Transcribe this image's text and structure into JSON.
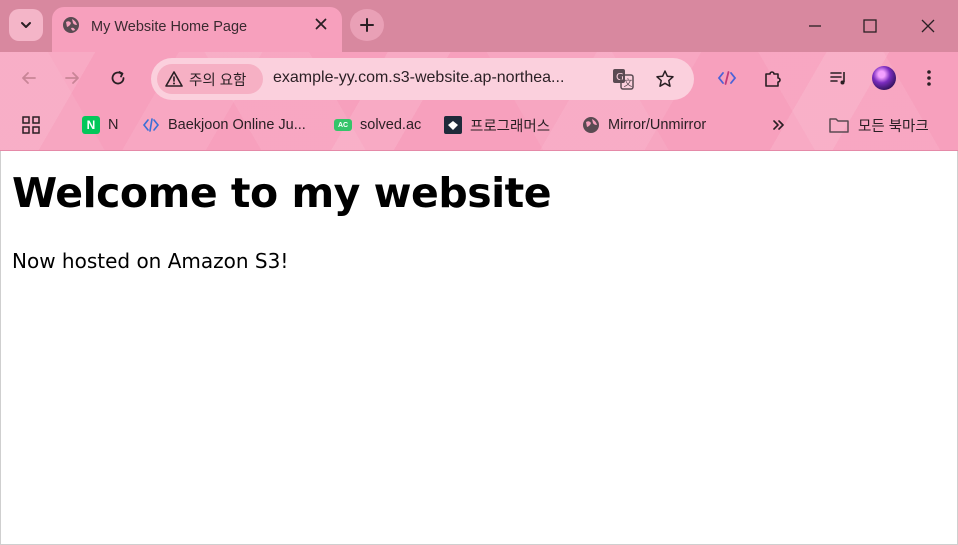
{
  "tab": {
    "title": "My Website Home Page",
    "favicon": "globe-icon"
  },
  "toolbar": {
    "security_chip": "주의 요함",
    "url": "example-yy.com.s3-website.ap-northea..."
  },
  "bookmarks": {
    "items": [
      {
        "label": "N",
        "icon": "naver-icon"
      },
      {
        "label": "Baekjoon Online Ju...",
        "icon": "code-icon"
      },
      {
        "label": "solved.ac",
        "icon": "solvedac-icon"
      },
      {
        "label": "프로그래머스",
        "icon": "programmers-icon"
      },
      {
        "label": "Mirror/Unmirror",
        "icon": "globe-icon"
      }
    ],
    "all_bookmarks": "모든 북마크"
  },
  "page": {
    "heading": "Welcome to my website",
    "paragraph": "Now hosted on Amazon S3!"
  },
  "colors": {
    "theme_pink": "#f7a0bd",
    "tabstrip": "#d8889f",
    "omnibox": "#fbd0dd"
  }
}
